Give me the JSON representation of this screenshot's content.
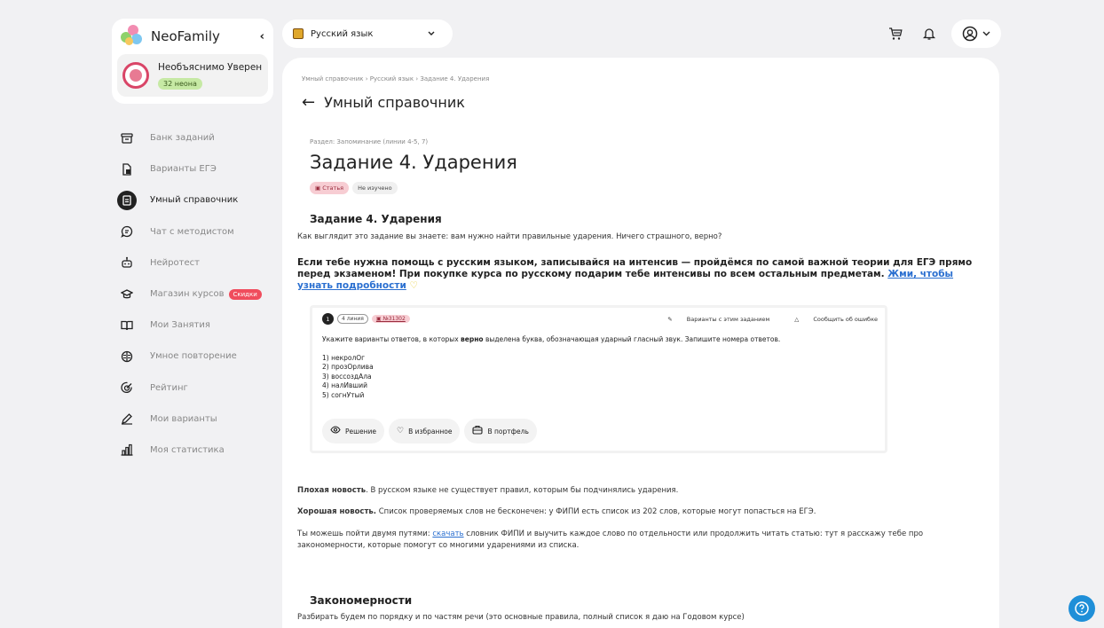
{
  "brand": {
    "name": "NeoFamily",
    "collapse_icon": "chevron-left-icon"
  },
  "user": {
    "name": "Необъяснимо Увереннь",
    "neon": "32 неона"
  },
  "nav": [
    {
      "label": "Банк заданий",
      "icon": "archive-icon",
      "active": false
    },
    {
      "label": "Варианты ЕГЭ",
      "icon": "docs-icon",
      "active": false
    },
    {
      "label": "Умный справочник",
      "icon": "book-icon",
      "active": true
    },
    {
      "label": "Чат с методистом",
      "icon": "chat-icon",
      "active": false
    },
    {
      "label": "Нейротест",
      "icon": "robot-icon",
      "active": false
    },
    {
      "label": "Магазин курсов",
      "icon": "graduation-icon",
      "active": false,
      "badge": "Скидки"
    },
    {
      "label": "Мои Занятия",
      "icon": "open-book-icon",
      "active": false
    },
    {
      "label": "Умное повторение",
      "icon": "brain-icon",
      "active": false
    },
    {
      "label": "Рейтинг",
      "icon": "target-icon",
      "active": false
    },
    {
      "label": "Мои варианты",
      "icon": "pencil-icon",
      "active": false
    },
    {
      "label": "Моя статистика",
      "icon": "chart-icon",
      "active": false
    }
  ],
  "subject": {
    "label": "Русский язык"
  },
  "breadcrumb": {
    "a": "Умный справочник",
    "b": "Русский язык",
    "c": "Задание 4. Ударения",
    "sep": "›"
  },
  "page_title": "Умный справочник",
  "section_label": "Раздел: Запоминание (линии 4-5, 7)",
  "task_title": "Задание 4. Ударения",
  "tags": {
    "article": "Статья",
    "status": "Не изучено"
  },
  "content": {
    "h_task": "Задание 4. Ударения",
    "intro": "Как выглядит это задание вы знаете: вам нужно найти правильные ударения. Ничего страшного, верно?",
    "promo_text": "Если тебе нужна помощь с русским языком, записывайся на интенсив — пройдёмся по самой важной теории для ЕГЭ прямо перед экзаменом! При покупке курса по русскому подарим тебе интенсивы по всем остальным предметам. ",
    "promo_link": "Жми, чтобы узнать подробности",
    "bad_bold": "Плохая новость",
    "bad_rest": ". В русском языке не существует правил, которым бы подчинялись ударения.",
    "good_bold": "Хорошая новость.",
    "good_rest": " Список проверяемых слов не бесконечен: у ФИПИ есть список из 202 слов, которые могут попасться на ЕГЭ.",
    "paths_a": "Ты можешь пойти двумя путями: ",
    "paths_link": "скачать",
    "paths_b": " словник ФИПИ и выучить каждое слово по отдельности или продолжить читать статью: тут я расскажу тебе про закономерности, которые помогут со многими ударениями из списка.",
    "h_patterns": "Закономерности",
    "patterns_text": "Разбирать будем по порядку и по частям речи (это основные правила, полный список я даю на Годовом курсе)"
  },
  "exercise": {
    "number": "1",
    "line": "4 линия",
    "id": "№31302",
    "action_variants": "Варианты с этим заданием",
    "action_report": "Сообщить об ошибке",
    "question_a": "Укажите варианты ответов, в которых ",
    "question_bold": "верно",
    "question_b": " выделена буква, обозначающая ударный гласный звук. Запишите номера ответов.",
    "options": [
      "1) некролОг",
      "2) прозОрлива",
      "3) воссоздАла",
      "4) налИвший",
      "5) согнУтый"
    ],
    "btn_solution": "Решение",
    "btn_favorite": "В избранное",
    "btn_portfolio": "В портфель"
  },
  "colors": {
    "accent_pink": "#d94567",
    "link": "#2a6fd0",
    "help": "#1f8fd8",
    "neon_badge": "#c6e9a4"
  }
}
